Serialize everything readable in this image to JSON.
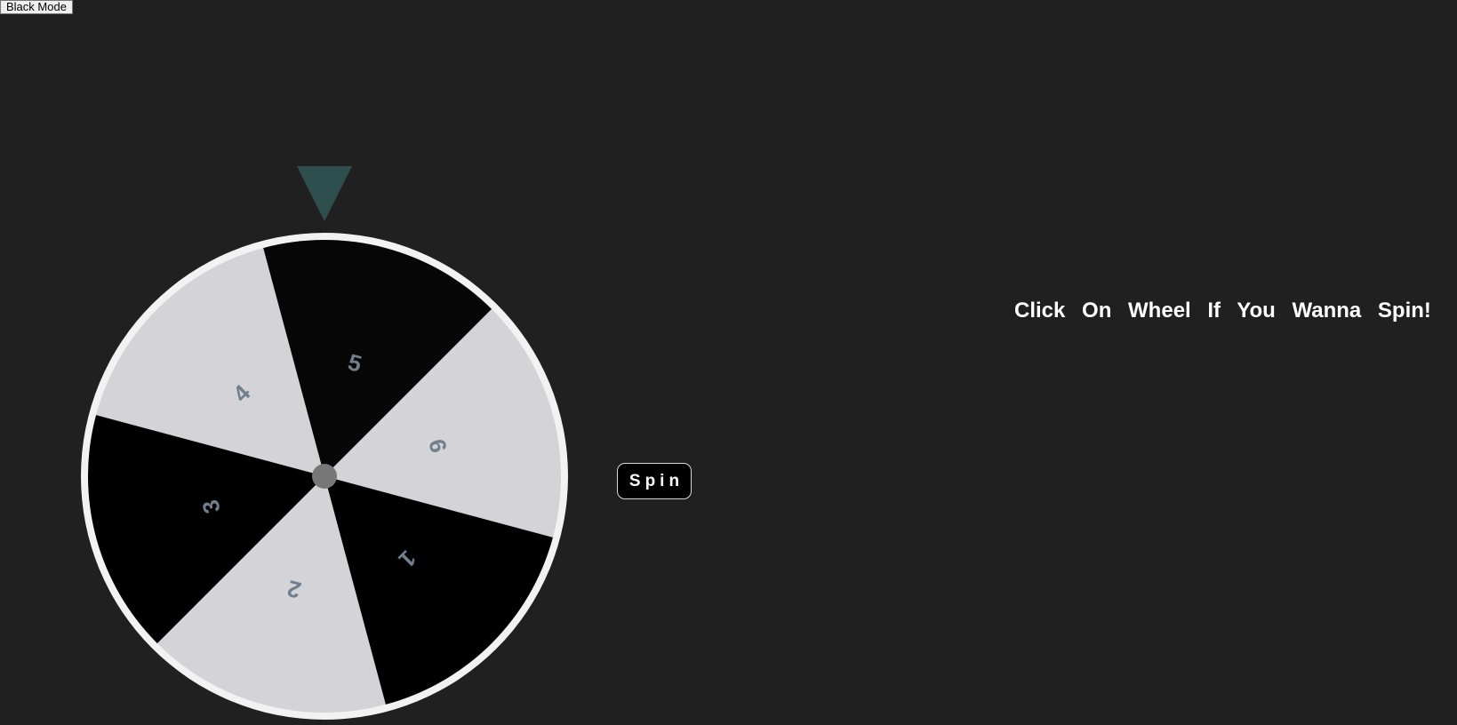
{
  "mode_toggle": {
    "label": "Black Mode"
  },
  "wheel": {
    "segments": [
      {
        "label": "4",
        "color": "#d3d3d8"
      },
      {
        "label": "5",
        "color": "#060606"
      },
      {
        "label": "6",
        "color": "#d3d3d8"
      },
      {
        "label": "1",
        "color": "#000000"
      },
      {
        "label": "2",
        "color": "#d3d3d8"
      },
      {
        "label": "3",
        "color": "#000000"
      }
    ],
    "rim_color": "#f2f2f2",
    "hub_color": "#777777",
    "label_color": "#6f7f8e",
    "pointer_color": "#2e4f4d"
  },
  "spin_button": {
    "label": "Spin"
  },
  "instruction": {
    "text": "Click On Wheel If You Wanna Spin!"
  }
}
